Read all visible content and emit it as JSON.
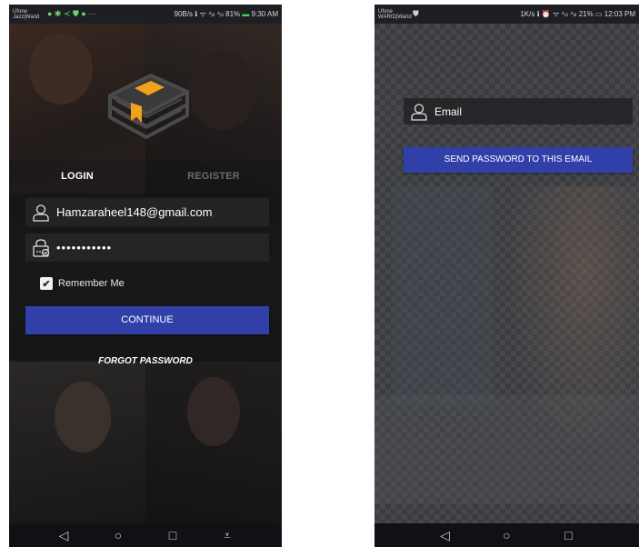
{
  "left_screen": {
    "status": {
      "carrier_top": "Ufone",
      "carrier_bottom": "Jazz|Warid",
      "icons_left": "● ✱ ≺ ⛊ ● ···",
      "speed": "90B/s",
      "icons_right": "ℹ ᯤ ⁴ᵢₗₗ ⁴ᵢₗₗ",
      "battery": "81%",
      "time": "9:30 AM"
    },
    "tabs": {
      "login": "LOGIN",
      "register": "REGISTER"
    },
    "email_value": "Hamzaraheel148@gmail.com",
    "password_value": "•••••••••••",
    "remember_label": "Remember Me",
    "continue_label": "CONTINUE",
    "forgot_label": "FORGOT PASSWORD",
    "nav": {
      "back": "◁",
      "home": "○",
      "recents": "□",
      "extra": "⩡"
    }
  },
  "right_screen": {
    "status": {
      "carrier_top": "Ufone",
      "carrier_bottom": "WARID|Warid",
      "speed": "1K/s",
      "icons_right": "ℹ ⏰ ᯤ ⁴ᵢₗₗ ⁴ᵢₗₗ",
      "battery": "21%",
      "time": "12:03 PM"
    },
    "email_placeholder": "Email",
    "send_label": "SEND PASSWORD TO THIS EMAIL",
    "nav": {
      "back": "◁",
      "home": "○",
      "recents": "□"
    }
  },
  "colors": {
    "accent": "#3140a8",
    "logo_orange": "#f0a21c",
    "logo_gray": "#4a4a4a"
  }
}
